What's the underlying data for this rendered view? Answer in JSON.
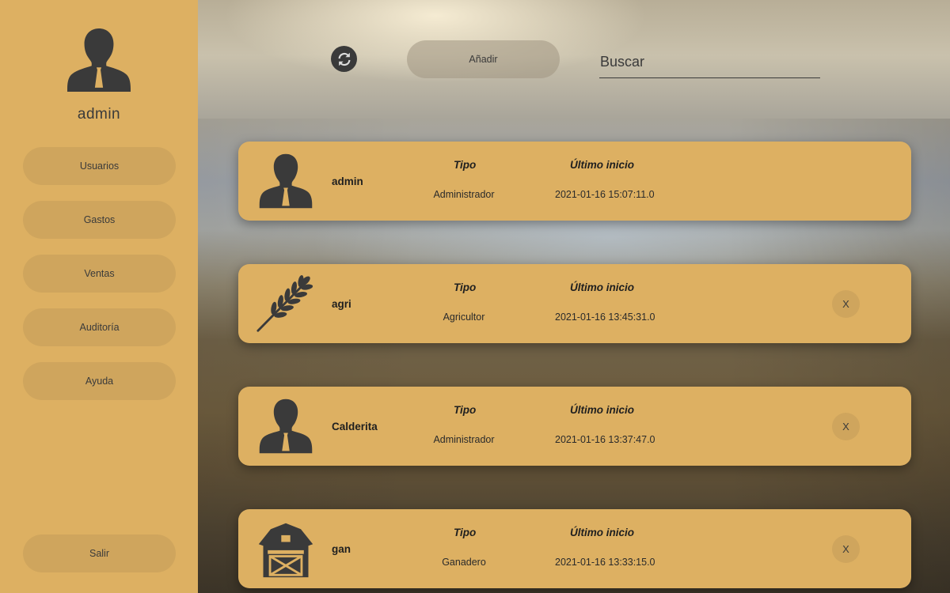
{
  "sidebar": {
    "username": "admin",
    "nav": [
      {
        "label": "Usuarios"
      },
      {
        "label": "Gastos"
      },
      {
        "label": "Ventas"
      },
      {
        "label": "Auditoría"
      },
      {
        "label": "Ayuda"
      }
    ],
    "logout_label": "Salir"
  },
  "toolbar": {
    "refresh_icon": "refresh-icon",
    "add_label": "Añadir",
    "search_placeholder": "Buscar"
  },
  "headers": {
    "tipo": "Tipo",
    "ultimo": "Último inicio"
  },
  "users": [
    {
      "name": "admin",
      "tipo": "Administrador",
      "ultimo": "2021-01-16 15:07:11.0",
      "icon": "person-icon",
      "deletable": false
    },
    {
      "name": "agri",
      "tipo": "Agricultor",
      "ultimo": "2021-01-16 13:45:31.0",
      "icon": "wheat-icon",
      "deletable": true,
      "delete_label": "X"
    },
    {
      "name": "Calderita",
      "tipo": "Administrador",
      "ultimo": "2021-01-16 13:37:47.0",
      "icon": "person-icon",
      "deletable": true,
      "delete_label": "X"
    },
    {
      "name": "gan",
      "tipo": "Ganadero",
      "ultimo": "2021-01-16 13:33:15.0",
      "icon": "barn-icon",
      "deletable": true,
      "delete_label": "X"
    }
  ],
  "colors": {
    "panel": "#ddb062",
    "button": "#cfa55d",
    "dark": "#3a3a3a"
  }
}
